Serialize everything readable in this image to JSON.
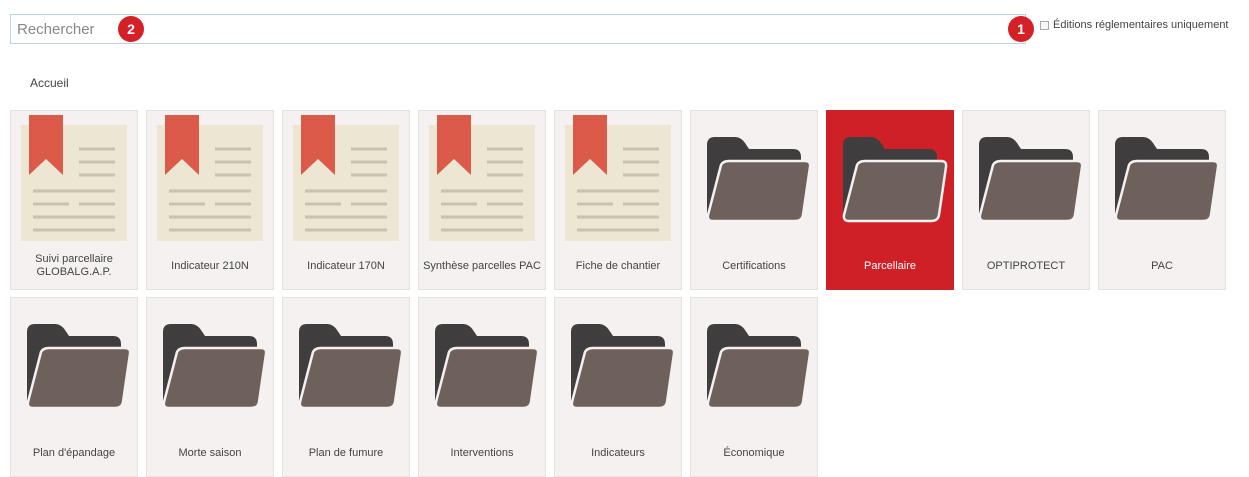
{
  "search": {
    "placeholder": "Rechercher"
  },
  "markers": {
    "filter": "1",
    "search": "2"
  },
  "filter": {
    "label": "Éditions réglementaires uniquement",
    "checked": false
  },
  "breadcrumb": {
    "root": "Accueil"
  },
  "colors": {
    "accent": "#cf2027",
    "tile_bg": "#f4f1f0",
    "folder_back": "#3f3d3e",
    "folder_front": "#6e615c",
    "document_bg": "#ece6d3",
    "bookmark": "#dc5a4a"
  },
  "tiles": [
    {
      "label": "Suivi parcellaire GLOBALG.A.P.",
      "icon": "document-icon"
    },
    {
      "label": "Indicateur 210N",
      "icon": "document-icon"
    },
    {
      "label": "Indicateur 170N",
      "icon": "document-icon"
    },
    {
      "label": "Synthèse parcelles PAC",
      "icon": "document-icon"
    },
    {
      "label": "Fiche de chantier",
      "icon": "document-icon"
    },
    {
      "label": "Certifications",
      "icon": "folder-icon"
    },
    {
      "label": "Parcellaire",
      "icon": "folder-icon",
      "selected": true
    },
    {
      "label": "OPTIPROTECT",
      "icon": "folder-icon"
    },
    {
      "label": "PAC",
      "icon": "folder-icon"
    },
    {
      "label": "Plan d'épandage",
      "icon": "folder-icon"
    },
    {
      "label": "Morte saison",
      "icon": "folder-icon"
    },
    {
      "label": "Plan de fumure",
      "icon": "folder-icon"
    },
    {
      "label": "Interventions",
      "icon": "folder-icon"
    },
    {
      "label": "Indicateurs",
      "icon": "folder-icon"
    },
    {
      "label": "Économique",
      "icon": "folder-icon"
    }
  ]
}
